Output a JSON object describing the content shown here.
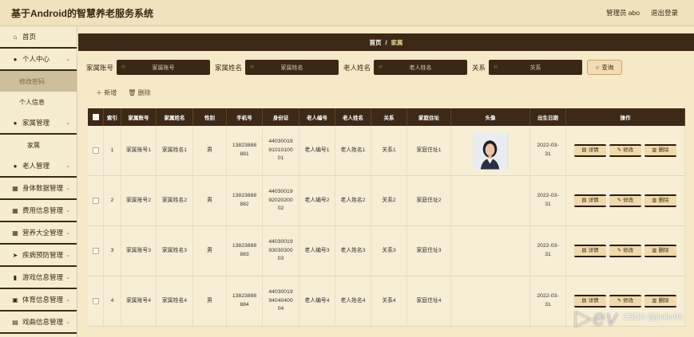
{
  "app": {
    "title": "基于Android的智慧养老服务系统",
    "user": "管理员 abo",
    "logout": "退出登录"
  },
  "sidebar": {
    "home": "首页",
    "personal": "个人中心",
    "personal_sub": [
      "修改密码",
      "个人信息"
    ],
    "family_mgmt": "家属管理",
    "family_sub": "家属",
    "items": [
      "老人管理",
      "身体数据管理",
      "费用信息管理",
      "营养大全管理",
      "疾病预防管理",
      "游戏信息管理",
      "体育信息管理",
      "戏曲信息管理"
    ]
  },
  "breadcrumb": {
    "home": "首页",
    "sep": "/",
    "current": "家属"
  },
  "search": {
    "f1_label": "家属账号",
    "f1_placeholder": "家属账号",
    "f2_label": "家属姓名",
    "f2_placeholder": "家属姓名",
    "f3_label": "老人姓名",
    "f3_placeholder": "老人姓名",
    "f4_label": "关系",
    "f4_placeholder": "关系",
    "query": "查询"
  },
  "actions": {
    "add": "新增",
    "delete": "删除"
  },
  "table": {
    "headers": [
      "索引",
      "家属账号",
      "家属姓名",
      "性别",
      "手机号",
      "身份证",
      "老人编号",
      "老人姓名",
      "关系",
      "家庭住址",
      "头像",
      "出生日期",
      "操作"
    ],
    "rows": [
      {
        "idx": "1",
        "acct": "家属账号1",
        "name": "家属姓名1",
        "sex": "男",
        "phone1": "13823888",
        "phone2": "881",
        "id1": "44030019",
        "id2": "91010100",
        "id3": "01",
        "eno": "老人编号1",
        "ename": "老人姓名1",
        "rel": "关系1",
        "addr": "家庭住址1",
        "bd1": "2022-03-",
        "bd2": "31"
      },
      {
        "idx": "2",
        "acct": "家属账号2",
        "name": "家属姓名2",
        "sex": "男",
        "phone1": "13823888",
        "phone2": "882",
        "id1": "44030019",
        "id2": "92020200",
        "id3": "02",
        "eno": "老人编号2",
        "ename": "老人姓名2",
        "rel": "关系2",
        "addr": "家庭住址2",
        "bd1": "2022-03-",
        "bd2": "31"
      },
      {
        "idx": "3",
        "acct": "家属账号3",
        "name": "家属姓名3",
        "sex": "男",
        "phone1": "13823888",
        "phone2": "883",
        "id1": "44030019",
        "id2": "93030300",
        "id3": "03",
        "eno": "老人编号3",
        "ename": "老人姓名3",
        "rel": "关系3",
        "addr": "家庭住址3",
        "bd1": "2022-03-",
        "bd2": "31"
      },
      {
        "idx": "4",
        "acct": "家属账号4",
        "name": "家属姓名4",
        "sex": "男",
        "phone1": "13823888",
        "phone2": "884",
        "id1": "44030019",
        "id2": "94040400",
        "id3": "04",
        "eno": "老人编号4",
        "ename": "老人姓名4",
        "rel": "关系4",
        "addr": "家庭住址4",
        "bd1": "2022-03-",
        "bd2": "31"
      }
    ],
    "ops": {
      "detail": "详情",
      "edit": "修改",
      "delete": "删除"
    }
  },
  "watermark": "CSDN @jinkin03",
  "colors": {
    "dark": "#3d2916",
    "bg": "#f5e9c8",
    "button": "#f0d9ab"
  }
}
